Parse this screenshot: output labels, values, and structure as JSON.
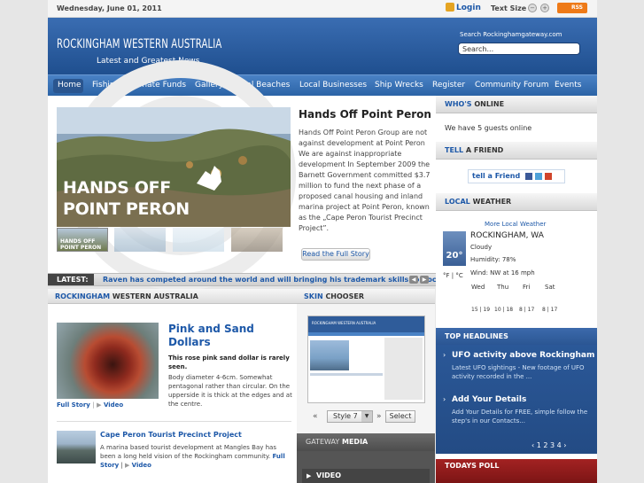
{
  "topbar": {
    "date": "Wednesday, June 01, 2011",
    "login": "Login",
    "text_size_label": "Text Size",
    "rss": "RSS"
  },
  "header": {
    "title": "ROCKINGHAM WESTERN AUSTRALIA",
    "subtitle": "Latest and Greatest News",
    "search_label": "Search Rockinghamgateway.com",
    "search_value": "Search..."
  },
  "nav": {
    "items": [
      "Home",
      "Fishing",
      "Donate Funds",
      "Gallery",
      "Local Beaches",
      "Local Businesses",
      "Ship Wrecks",
      "Register",
      "Community Forum",
      "Events"
    ]
  },
  "feature": {
    "image_line1": "HANDS OFF",
    "image_line2": "POINT PERON",
    "thumb_caption_1": "HANDS OFF",
    "thumb_caption_2": "POINT PERON",
    "title": "Hands Off Point Peron",
    "text": "Hands Off Point Peron Group are not against development at Point Peron We are against inappropriate development In September 2009 the Barnett Government committed $3.7 million to fund the next phase of a proposed canal housing and inland marina project at Point Peron, known as the „Cape Peron Tourist Precinct Project”.",
    "read_more": "Read the Full Story"
  },
  "latest": {
    "label": "LATEST:",
    "text": "Raven has competed around the world and will bringing his trademark skills to Rocking..."
  },
  "rockingham_section": {
    "title_a": "ROCKINGHAM",
    "title_b": "WESTERN AUSTRALIA",
    "article1": {
      "title": "Pink and Sand Dollars",
      "bold": "This rose pink sand dollar is rarely seen.",
      "text": "Body diameter 4-6cm. Somewhat pentagonal rather than circular. On the upperside it is thick at the edges and at the centre.",
      "full_story": "Full Story",
      "separator": "|",
      "video": "Video"
    },
    "article2": {
      "title": "Cape Peron Tourist Precinct Project",
      "text": "A marina based tourist development at Mangles Bay has been a long held vision of the Rockingham community.",
      "full_story": "Full Story",
      "separator": "|",
      "video": "Video"
    }
  },
  "skin": {
    "title_a": "SKIN",
    "title_b": "CHOOSER",
    "preview_title": "ROCKINGHAM WESTERN AUSTRALIA",
    "prev": "«",
    "next": "»",
    "selected": "Style 7",
    "select_button": "Select"
  },
  "gateway": {
    "title_a": "GATEWAY",
    "title_b": "MEDIA",
    "video": "VIDEO"
  },
  "whos_online": {
    "title_a": "WHO'S",
    "title_b": "ONLINE",
    "text": "We have 5 guests online"
  },
  "tell_friend": {
    "title_a": "TELL",
    "title_b": "A FRIEND",
    "button": "tell a Friend"
  },
  "weather": {
    "title_a": "LOCAL",
    "title_b": "WEATHER",
    "more": "More Local Weather",
    "temp": "20°",
    "city": "ROCKINGHAM, WA",
    "condition": "Cloudy",
    "humidity": "Humidity: 78%",
    "wind": "Wind: NW at 16 mph",
    "units": "°F | °C",
    "days": [
      "Wed",
      "Thu",
      "Fri",
      "Sat"
    ],
    "temps": [
      "15 | 19",
      "10 | 18",
      "8 | 17",
      "8 | 17"
    ]
  },
  "headlines": {
    "title": "TOP HEADLINES",
    "items": [
      {
        "title": "UFO activity above Rockingham",
        "text": "Latest UFO sightings - New footage of UFO activity recorded in the ..."
      },
      {
        "title": "Add Your Details",
        "text": "Add Your Details for FREE, simple follow the step's in our Contacts..."
      }
    ],
    "pager": "‹  1  2  3  4  ›"
  },
  "poll": {
    "title": "TODAYS POLL"
  },
  "colors": {
    "brand_blue": "#1d58a8",
    "header_blue": "#2f5c9a",
    "poll_red": "#a32222"
  }
}
